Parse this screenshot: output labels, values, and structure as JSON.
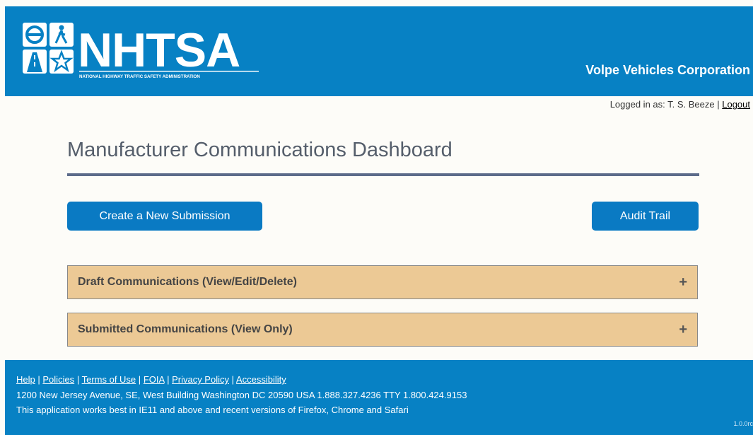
{
  "header": {
    "logo_text": "NHTSA",
    "logo_subtitle": "NATIONAL HIGHWAY TRAFFIC SAFETY ADMINISTRATION",
    "company": "Volpe Vehicles Corporation"
  },
  "user": {
    "logged_in_label": "Logged in as: T. S. Beeze |",
    "logout_label": "Logout"
  },
  "page": {
    "title": "Manufacturer Communications Dashboard"
  },
  "buttons": {
    "create_label": "Create a New Submission",
    "audit_label": "Audit Trail"
  },
  "accordions": {
    "draft_label": "Draft Communications (View/Edit/Delete)",
    "submitted_label": "Submitted Communications (View Only)",
    "expand_symbol": "+"
  },
  "footer": {
    "links": [
      "Help",
      "Policies",
      "Terms of Use",
      "FOIA",
      "Privacy Policy",
      "Accessibility"
    ],
    "separator": "|",
    "address": "1200 New Jersey Avenue, SE, West Building Washington DC 20590 USA 1.888.327.4236 TTY 1.800.424.9153",
    "browser_note": "This application works best in IE11 and above and recent versions of Firefox, Chrome and Safari",
    "version": "1.0.0rc"
  },
  "colors": {
    "header_bg": "#0781c4",
    "button_bg": "#0a7ac3",
    "accordion_bg": "#ecc995",
    "rule": "#5c6b8a"
  }
}
